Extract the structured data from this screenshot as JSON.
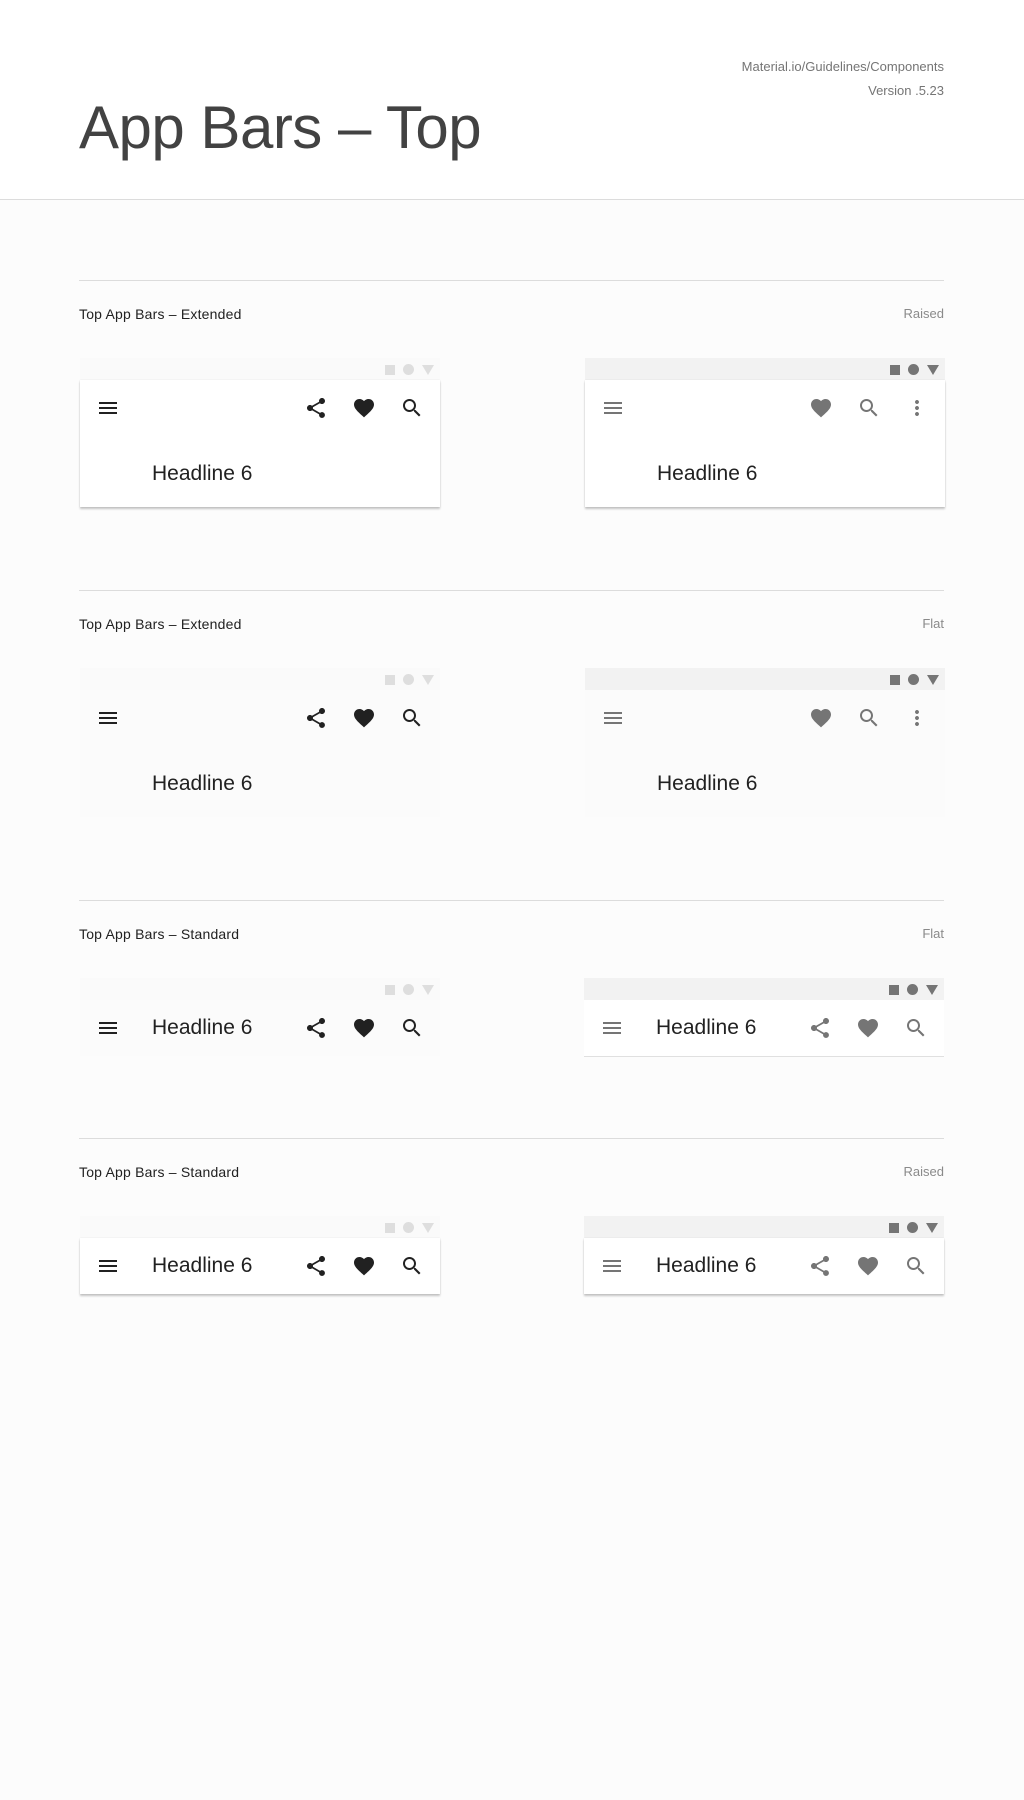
{
  "header": {
    "title": "App Bars – Top",
    "source": "Material.io/Guidelines/Components",
    "version": "Version .5.23"
  },
  "sections": [
    {
      "title": "Top App Bars – Extended",
      "tag": "Raised",
      "left": {
        "headline": "Headline 6",
        "icons": [
          "menu-icon",
          "share-icon",
          "heart-icon",
          "search-icon"
        ]
      },
      "right": {
        "headline": "Headline 6",
        "icons": [
          "menu-icon",
          "heart-icon",
          "search-icon",
          "more-vert-icon"
        ]
      }
    },
    {
      "title": "Top App Bars – Extended",
      "tag": "Flat",
      "left": {
        "headline": "Headline 6",
        "icons": [
          "menu-icon",
          "share-icon",
          "heart-icon",
          "search-icon"
        ]
      },
      "right": {
        "headline": "Headline 6",
        "icons": [
          "menu-icon",
          "heart-icon",
          "search-icon",
          "more-vert-icon"
        ]
      }
    },
    {
      "title": "Top App Bars – Standard",
      "tag": "Flat",
      "left": {
        "headline": "Headline 6",
        "icons": [
          "menu-icon",
          "share-icon",
          "heart-icon",
          "search-icon"
        ]
      },
      "right": {
        "headline": "Headline 6",
        "icons": [
          "menu-icon",
          "share-icon",
          "heart-icon",
          "search-icon"
        ]
      }
    },
    {
      "title": "Top App Bars – Standard",
      "tag": "Raised",
      "left": {
        "headline": "Headline 6",
        "icons": [
          "menu-icon",
          "share-icon",
          "heart-icon",
          "search-icon"
        ]
      },
      "right": {
        "headline": "Headline 6",
        "icons": [
          "menu-icon",
          "share-icon",
          "heart-icon",
          "search-icon"
        ]
      }
    }
  ],
  "colors": {
    "dark_icon": "#212121",
    "gray_icon": "#757575",
    "divider": "#dcdcdc"
  }
}
